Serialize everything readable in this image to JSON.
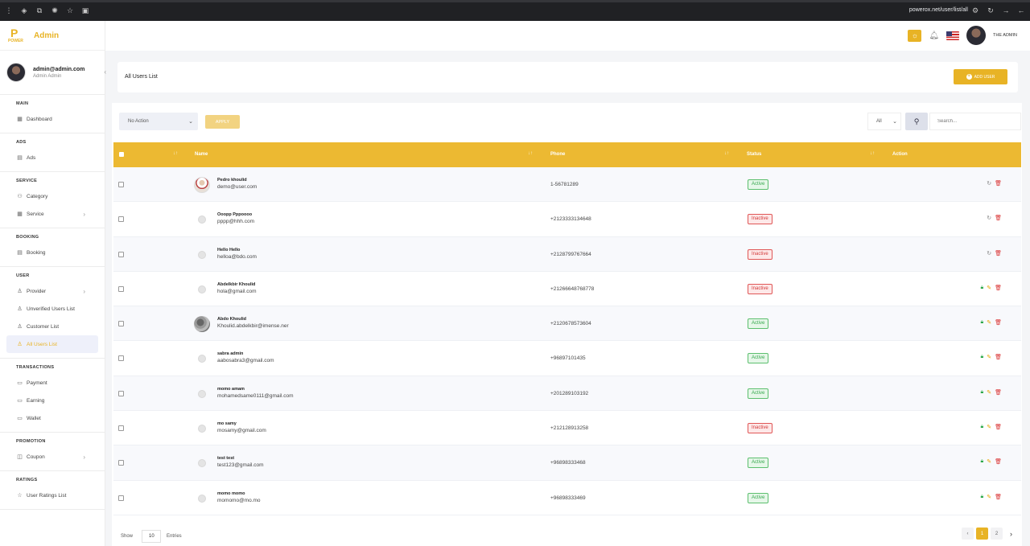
{
  "browser": {
    "url": "powerox.net/user/list/all"
  },
  "brand": {
    "logo_small": "POWER",
    "name": "Admin",
    "accent": "#ecb932"
  },
  "profile": {
    "email": "admin@admin.com",
    "role": "Admin Admin"
  },
  "topbar": {
    "user_name": "THE ADMIN"
  },
  "sidebar": {
    "sections": [
      {
        "title": "MAIN",
        "items": [
          {
            "label": "Dashboard",
            "icon": "grid-icon"
          }
        ]
      },
      {
        "title": "ADS",
        "items": [
          {
            "label": "Ads",
            "icon": "calendar-icon"
          }
        ]
      },
      {
        "title": "SERVICE",
        "items": [
          {
            "label": "Category",
            "icon": "users-icon"
          },
          {
            "label": "Service",
            "icon": "grid-icon",
            "chevron": true
          }
        ]
      },
      {
        "title": "BOOKING",
        "items": [
          {
            "label": "Booking",
            "icon": "calendar-icon"
          }
        ]
      },
      {
        "title": "USER",
        "items": [
          {
            "label": "Provider",
            "icon": "user-icon",
            "chevron": true
          },
          {
            "label": "Unverified Users List",
            "icon": "user-icon"
          },
          {
            "label": "Customer List",
            "icon": "user-icon"
          },
          {
            "label": "All Users List",
            "icon": "user-icon",
            "active": true
          }
        ]
      },
      {
        "title": "TRANSACTIONS",
        "items": [
          {
            "label": "Payment",
            "icon": "wallet-icon"
          },
          {
            "label": "Earning",
            "icon": "wallet-icon"
          },
          {
            "label": "Wallet",
            "icon": "wallet-icon"
          }
        ]
      },
      {
        "title": "PROMOTION",
        "items": [
          {
            "label": "Coupon",
            "icon": "coupon-icon",
            "chevron": true
          }
        ]
      },
      {
        "title": "RATINGS",
        "items": [
          {
            "label": "User Ratings List",
            "icon": "star-icon"
          }
        ]
      }
    ]
  },
  "page": {
    "title": "All Users List",
    "add_label": "ADD USER"
  },
  "controls": {
    "bulk_action": "No Action",
    "apply_label": "APPLY",
    "filter": "All",
    "search_placeholder": "Search..."
  },
  "table": {
    "columns": [
      "Name",
      "Phone",
      "Status",
      "Action"
    ],
    "rows": [
      {
        "name": "Pedro khoulid",
        "email": "demo@user.com",
        "phone": "1-56781289",
        "status": "Active",
        "avatar": "photo1",
        "actions": "basic"
      },
      {
        "name": "Ooopp Pppoooo",
        "email": "pppp@hhh.com",
        "phone": "+2123333134648",
        "status": "Inactive",
        "avatar": "ph",
        "actions": "basic"
      },
      {
        "name": "Hello Hello",
        "email": "helloa@bdo.com",
        "phone": "+2128799767664",
        "status": "Inactive",
        "avatar": "ph",
        "actions": "basic"
      },
      {
        "name": "Abdelkbir Khoulid",
        "email": "hola@gmail.com",
        "phone": "+21266648768778",
        "status": "Inactive",
        "avatar": "ph",
        "actions": "full"
      },
      {
        "name": "Abdo Khoulid",
        "email": "Khoulid.abdelkbir@imense.ner",
        "phone": "+2120678573604",
        "status": "Active",
        "avatar": "photo2",
        "actions": "full"
      },
      {
        "name": "sabra admin",
        "email": "aabosabra3@gmail.com",
        "phone": "+96897101435",
        "status": "Active",
        "avatar": "ph",
        "actions": "full"
      },
      {
        "name": "momo amam",
        "email": "mohamedsame0111@gmail.com",
        "phone": "+201289103192",
        "status": "Active",
        "avatar": "ph",
        "actions": "full"
      },
      {
        "name": "mo samy",
        "email": "mosamy@gmail.com",
        "phone": "+212128913258",
        "status": "Inactive",
        "avatar": "ph",
        "actions": "full"
      },
      {
        "name": "test test",
        "email": "test123@gmail.com",
        "phone": "+96898333468",
        "status": "Active",
        "avatar": "ph",
        "actions": "full"
      },
      {
        "name": "momo momo",
        "email": "momomo@mo.mo",
        "phone": "+96898333469",
        "status": "Active",
        "avatar": "ph",
        "actions": "full"
      }
    ]
  },
  "footer": {
    "show_label": "Show",
    "page_size": "10",
    "entries_label": "Entries",
    "pages": [
      "1",
      "2"
    ],
    "current_page": "1"
  }
}
